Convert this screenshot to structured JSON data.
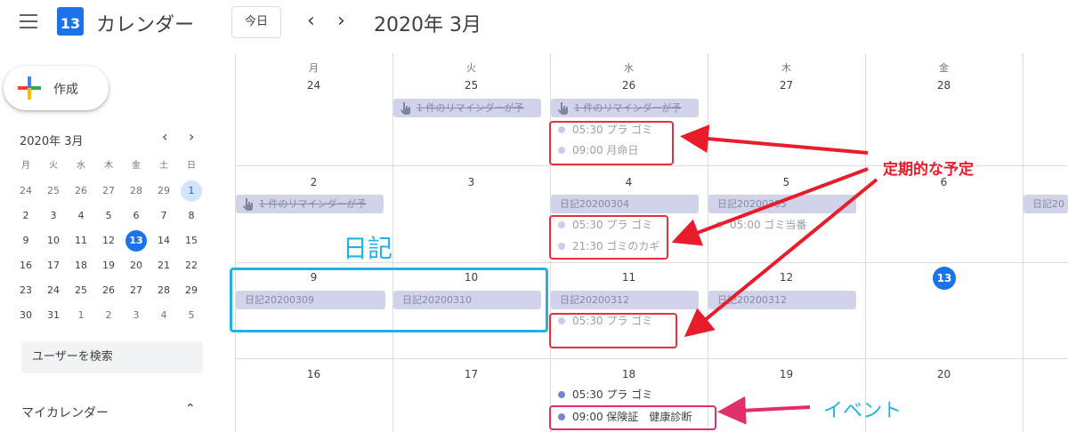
{
  "header": {
    "app_title": "カレンダー",
    "logo_day": "13",
    "today_button": "今日",
    "month_title": "2020年 3月",
    "prev_icon": "chevron-left",
    "next_icon": "chevron-right"
  },
  "sidebar": {
    "create_label": "作成",
    "mini_title": "2020年 3月",
    "weekdays": [
      "月",
      "火",
      "水",
      "木",
      "金",
      "土",
      "日"
    ],
    "weeks": [
      [
        "24",
        "25",
        "26",
        "27",
        "28",
        "29",
        "1"
      ],
      [
        "2",
        "3",
        "4",
        "5",
        "6",
        "7",
        "8"
      ],
      [
        "9",
        "10",
        "11",
        "12",
        "13",
        "14",
        "15"
      ],
      [
        "16",
        "17",
        "18",
        "19",
        "20",
        "21",
        "22"
      ],
      [
        "23",
        "24",
        "25",
        "26",
        "27",
        "28",
        "29"
      ],
      [
        "30",
        "31",
        "1",
        "2",
        "3",
        "4",
        "5"
      ]
    ],
    "search_placeholder": "ユーザーを検索",
    "my_calendars": "マイカレンダー"
  },
  "calendar": {
    "weekdays": [
      "月",
      "火",
      "水",
      "木",
      "金"
    ],
    "week_days": [
      [
        "24",
        "25",
        "26",
        "27",
        "28"
      ],
      [
        "2",
        "3",
        "4",
        "5",
        "6"
      ],
      [
        "9",
        "10",
        "11",
        "12",
        "13"
      ],
      [
        "16",
        "17",
        "18",
        "19",
        "20"
      ]
    ],
    "reminder_text": "1 件のリマインダーが予",
    "diary": {
      "d0304": "日記20200304",
      "d0305": "日記20200305",
      "d0306": "日記20",
      "d0309": "日記20200309",
      "d0310": "日記20200310",
      "d0312a": "日記20200312",
      "d0312b": "日記20200312"
    },
    "events": {
      "e26a": "05:30 プラ ゴミ",
      "e26b": "09:00 月命日",
      "e4a": "05:30 プラ ゴミ",
      "e4b": "21:30 ゴミのカギ",
      "e5a": "05:00 ゴミ当番",
      "e11a": "05:30 プラ ゴミ",
      "e18a": "05:30 プラ ゴミ",
      "e18b": "09:00 保険証　健康診断"
    }
  },
  "annotations": {
    "recurring": "定期的な予定",
    "diary": "日記",
    "event": "イベント"
  },
  "colors": {
    "accent": "#1a73e8",
    "chip_bg": "#d0d3e9",
    "annot_red": "#e81c2a",
    "annot_blue": "#1fb3e3",
    "annot_pink": "#e0306a"
  }
}
